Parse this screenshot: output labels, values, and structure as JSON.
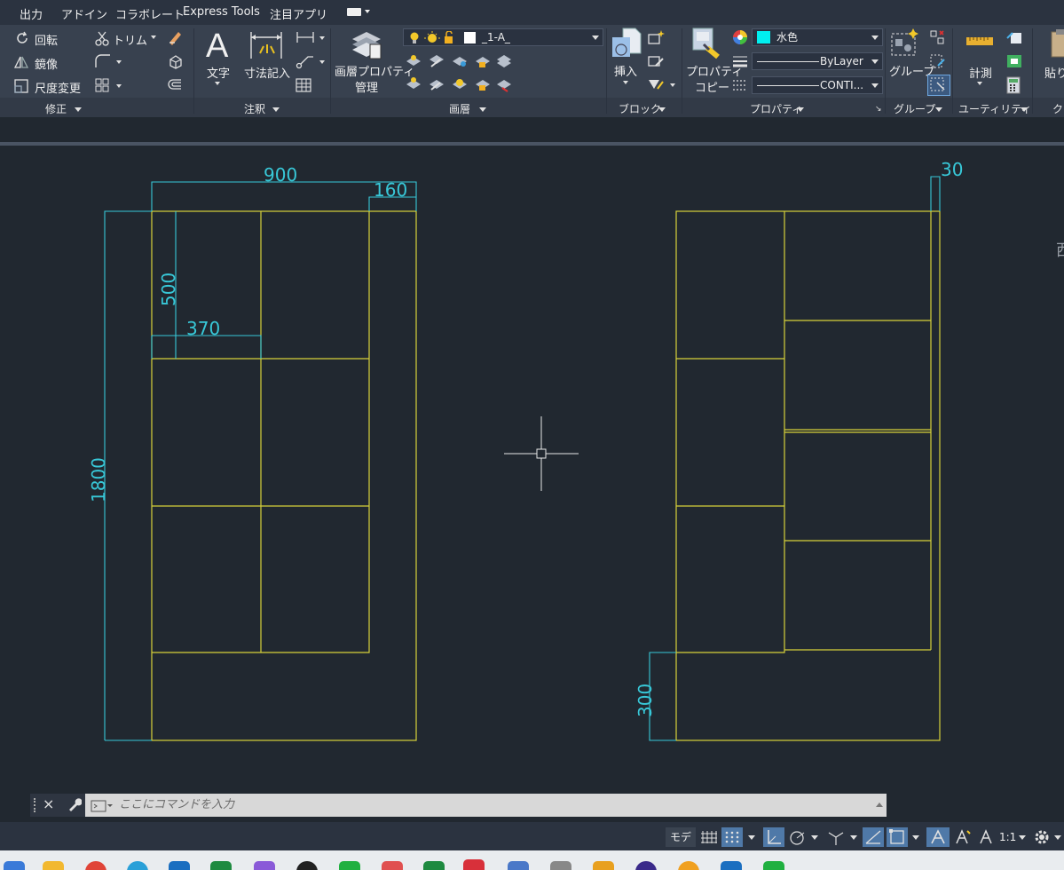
{
  "menubar": {
    "items": [
      "出力",
      "アドイン",
      "コラボレート",
      "Express Tools",
      "注目アプリ"
    ]
  },
  "ribbon": {
    "modify": {
      "title": "修正",
      "rotate": "回転",
      "mirror": "鏡像",
      "scale": "尺度変更",
      "trim": "トリム"
    },
    "annotation": {
      "title": "注釈",
      "text": "文字",
      "dimension": "寸法記入"
    },
    "layers": {
      "title": "画層",
      "layer_properties": "画層プロパティ",
      "layer_properties_2": "管理",
      "current_layer": "_1-A_"
    },
    "block": {
      "title": "ブロック",
      "insert": "挿入"
    },
    "properties": {
      "title": "プロパティ",
      "match": "プロパティ",
      "match_2": "コピー",
      "color": "水色",
      "lineweight": "ByLayer",
      "linetype": "CONTI..."
    },
    "groups": {
      "title": "グループ",
      "group": "グループ"
    },
    "utilities": {
      "title": "ユーティリティ",
      "measure": "計測"
    },
    "clipboard": {
      "paste": "貼り",
      "title": "ク"
    }
  },
  "drawing": {
    "dims": {
      "width": "900",
      "side": "160",
      "shelf_h": "500",
      "shelf_w": "370",
      "height": "1800",
      "right_top": "30",
      "base": "300"
    },
    "edge_text": "西"
  },
  "command": {
    "placeholder": "ここにコマンドを入力"
  },
  "status": {
    "model": "モデル",
    "scale": "1:1"
  },
  "colors": {
    "geometry": "#d8d23a",
    "dimension": "#38c8d8",
    "background": "#212830",
    "ribbon": "#38414f",
    "current_color_swatch": "#00f0f0"
  }
}
